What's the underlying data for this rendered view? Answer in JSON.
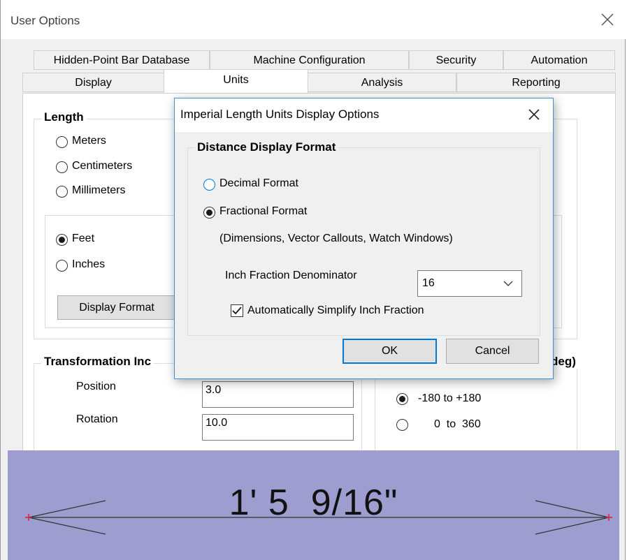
{
  "window": {
    "title": "User Options",
    "tabs_row1": [
      "Hidden-Point Bar Database",
      "Machine Configuration",
      "Security",
      "Automation"
    ],
    "tabs_row2": [
      "Display",
      "Units",
      "Analysis",
      "Reporting"
    ],
    "selected_tab": "Units"
  },
  "length_group": {
    "title": "Length",
    "metric_options": [
      "Meters",
      "Centimeters",
      "Millimeters"
    ],
    "imperial_options": [
      "Feet",
      "Inches"
    ],
    "selected": "Feet",
    "display_format_button": "Display Format"
  },
  "transformation_group": {
    "title": "Transformation Inc",
    "position_label": "Position",
    "position_value": "3.0",
    "rotation_label": "Rotation",
    "rotation_value": "10.0"
  },
  "angle_group": {
    "title_fragment": "deg)",
    "options": [
      "-180 to +180",
      "0  to  360"
    ],
    "selected": "-180 to +180"
  },
  "dialog": {
    "title": "Imperial Length Units Display Options",
    "group_title": "Distance Display Format",
    "decimal_label": "Decimal Format",
    "fractional_label": "Fractional Format",
    "selected": "Fractional Format",
    "note": "(Dimensions, Vector Callouts, Watch Windows)",
    "denominator_label": "Inch Fraction Denominator",
    "denominator_value": "16",
    "simplify_label": "Automatically Simplify Inch Fraction",
    "simplify_checked": true,
    "ok_label": "OK",
    "cancel_label": "Cancel"
  },
  "preview": {
    "dimension_text": "1' 5  9/16\"",
    "background": "#9d9dcf",
    "endpoint_color": "#e0203a"
  },
  "colors": {
    "accent": "#0078d7"
  }
}
